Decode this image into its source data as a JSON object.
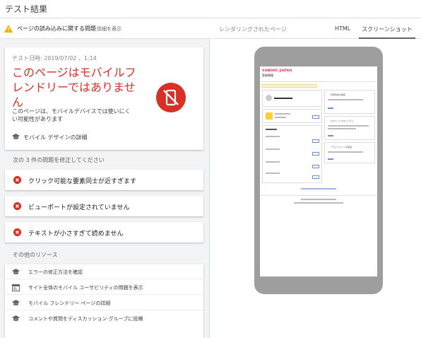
{
  "title": "テスト結果",
  "warning": {
    "text": "ページの読み込みに関する問題",
    "link": "詳細を表示"
  },
  "result": {
    "date": "テスト日時: 2019/07/02 、1:14",
    "headline": "このページはモバイルフレンドリーではありません",
    "description": "このページは、モバイルデバイスでは使いにくい可能性があります",
    "learn_more": "モバイル デザインの詳細",
    "status_color": "#d93025"
  },
  "issues_heading": "次の 3 件の問題を修正してください",
  "issues": [
    "クリック可能な要素同士が近すぎます",
    "ビューポートが設定されていません",
    "テキストが小さすぎて読めません"
  ],
  "resources_heading": "その他のリソース",
  "resources": [
    {
      "icon": "school-icon",
      "label": "エラーの修正方法を確認"
    },
    {
      "icon": "web-icon",
      "label": "サイト全体のモバイル ユーザビリティの問題を表示"
    },
    {
      "icon": "school-icon",
      "label": "モバイル フレンドリー ページの詳細"
    },
    {
      "icon": "school-icon",
      "label": "コメントや質問をディスカッション グループに投稿"
    }
  ],
  "right_panel": {
    "label": "レンダリングされたページ",
    "tabs": [
      "HTML",
      "スクリーンショット"
    ],
    "active_tab": "スクリーンショット"
  },
  "preview": {
    "logo": "YAHOO! JAPAN",
    "page_title": "登録情報",
    "boxes": [
      "登録情報の確認",
      "ログインとセキュリティ",
      "プライバシーへの配慮"
    ]
  }
}
